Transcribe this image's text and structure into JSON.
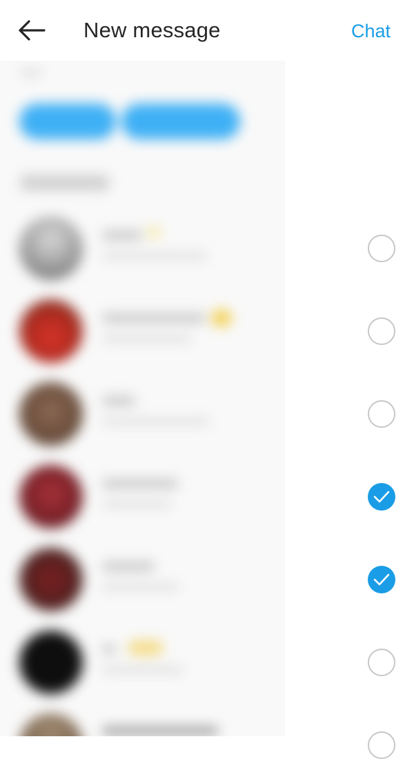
{
  "header": {
    "title": "New message",
    "chat_label": "Chat",
    "back_icon": "arrow-left-icon"
  },
  "colors": {
    "accent": "#1a9de6",
    "pill": "#3fb0f5",
    "unchecked_border": "#c7c7c7",
    "text": "#262626"
  },
  "contacts": [
    {
      "selected": false
    },
    {
      "selected": false
    },
    {
      "selected": false
    },
    {
      "selected": true
    },
    {
      "selected": true
    },
    {
      "selected": false
    },
    {
      "selected": false
    }
  ]
}
